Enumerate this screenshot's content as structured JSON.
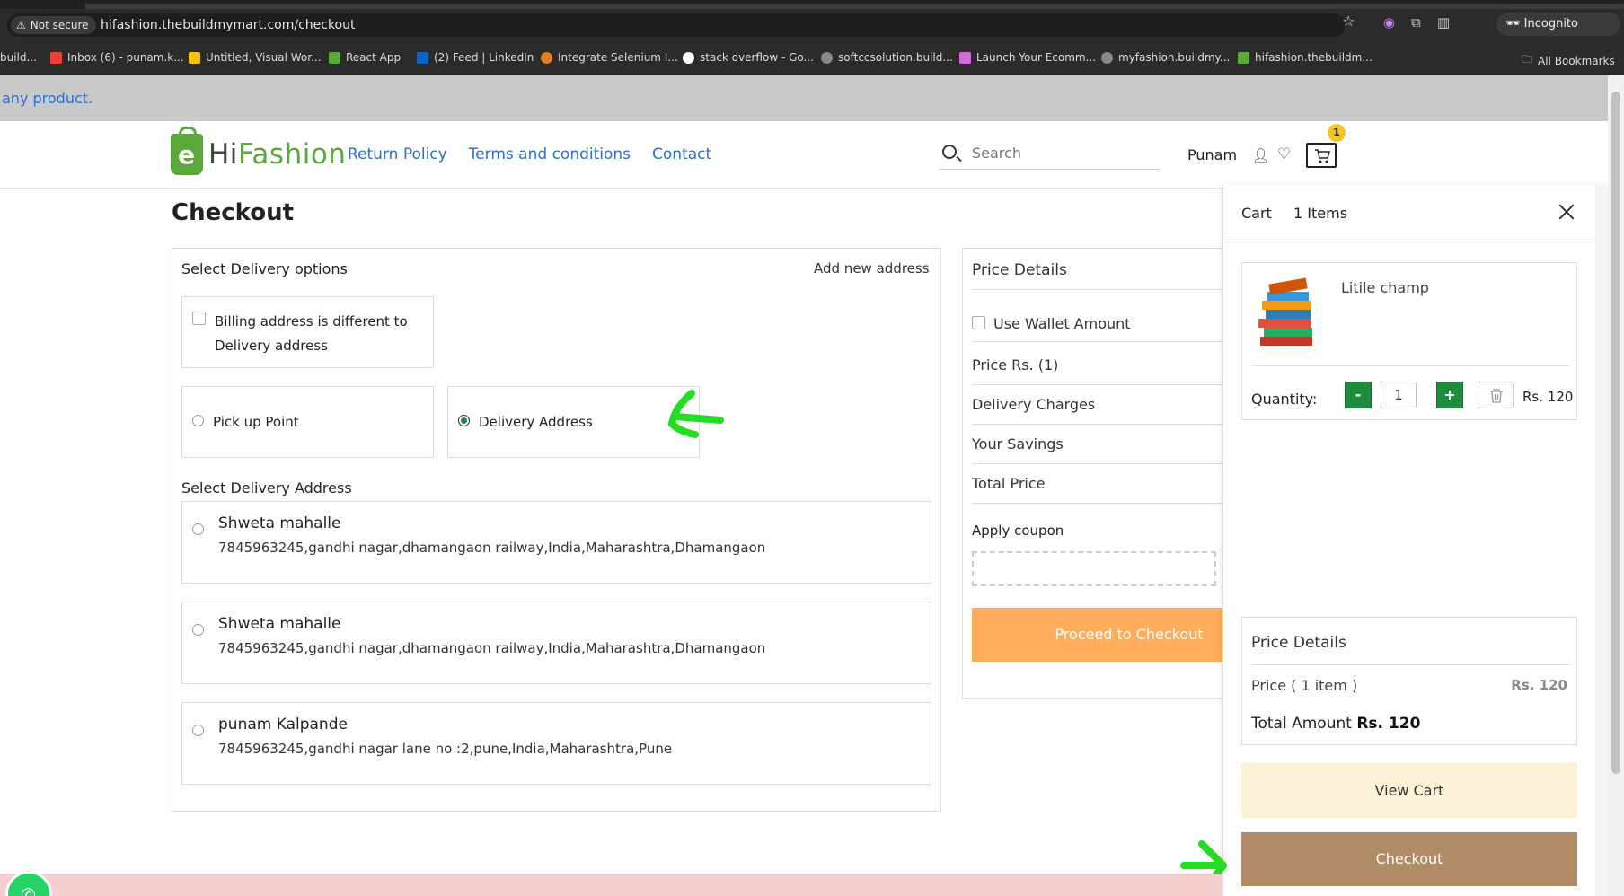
{
  "browser": {
    "security_label": "Not secure",
    "url": "hifashion.thebuildmymart.com/checkout",
    "profile_label": "Incognito",
    "bookmarks": [
      "build...",
      "Inbox (6) - punam.k...",
      "Untitled, Visual Wor...",
      "React App",
      "(2) Feed | LinkedIn",
      "Integrate Selenium I...",
      "stack overflow - Go...",
      "softccsolution.build...",
      "Launch Your Ecomm...",
      "myfashion.buildmy...",
      "hifashion.thebuildm...",
      "All Bookmarks"
    ]
  },
  "announcement": "any product.",
  "header": {
    "logo_letter": "e",
    "logo_hi": "Hi",
    "logo_fashion": "Fashion",
    "nav": [
      "Return Policy",
      "Terms and conditions",
      "Contact"
    ],
    "search_placeholder": "Search",
    "user_name": "Punam",
    "cart_count": "1"
  },
  "checkout": {
    "title": "Checkout",
    "delivery_options_title": "Select Delivery options",
    "add_new_address": "Add new address",
    "billing_checkbox_label": "Billing address is different to Delivery address",
    "options": [
      {
        "label": "Pick up Point",
        "selected": false
      },
      {
        "label": "Delivery Address",
        "selected": true
      }
    ],
    "select_address_title": "Select Delivery Address",
    "addresses": [
      {
        "name": "Shweta mahalle",
        "line": "7845963245,gandhi nagar,dhamangaon railway,India,Maharashtra,Dhamangaon"
      },
      {
        "name": "Shweta mahalle",
        "line": "7845963245,gandhi nagar,dhamangaon railway,India,Maharashtra,Dhamangaon"
      },
      {
        "name": "punam Kalpande",
        "line": "7845963245,gandhi nagar lane no :2,pune,India,Maharashtra,Pune"
      }
    ]
  },
  "price_details": {
    "title": "Price Details",
    "wallet_label": "Use Wallet Amount",
    "rows": [
      "Price Rs. (1)",
      "Delivery Charges",
      "Your Savings",
      "Total Price"
    ],
    "coupon_label": "Apply coupon",
    "proceed_label": "Proceed to Checkout"
  },
  "cart": {
    "title": "Cart",
    "count_label": "1 Items",
    "item": {
      "name": "Litile champ",
      "quantity_label": "Quantity:",
      "quantity": "1",
      "minus": "-",
      "plus": "+",
      "price": "Rs. 120"
    },
    "price_details": {
      "title": "Price Details",
      "price_label": "Price ( 1 item )",
      "price_value": "Rs. 120",
      "total_label": "Total Amount",
      "total_value": "Rs. 120"
    },
    "view_cart_label": "View Cart",
    "checkout_label": "Checkout"
  },
  "colors": {
    "brand_green": "#5aa83a",
    "link_blue": "#2c6fc8",
    "proceed_orange": "#ffad5c",
    "checkout_brown": "#b08b68",
    "qty_green": "#1e8e3e",
    "annotation_green": "#22dd22"
  }
}
